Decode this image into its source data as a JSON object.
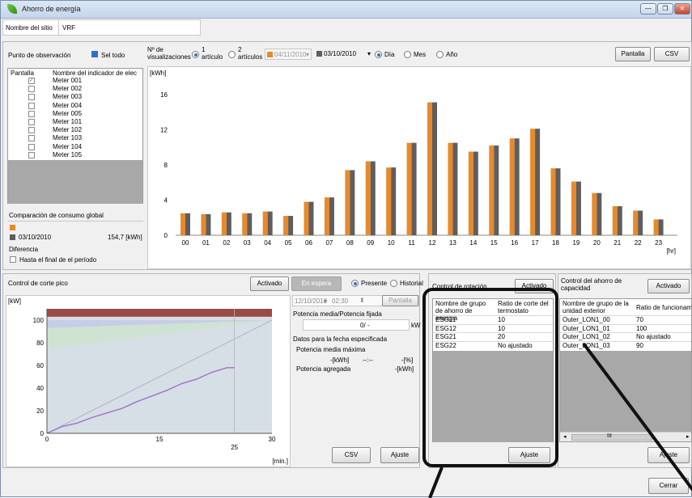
{
  "window": {
    "title": "Ahorro de energía",
    "min": "—",
    "max": "❐",
    "close": "✕"
  },
  "site": {
    "label": "Nombre del sitio",
    "value": "VRF"
  },
  "observation": {
    "label": "Punto de observación",
    "select_all": "Sel todo",
    "col_pantalla": "Pantalla",
    "col_name": "Nombre del indicador de elec",
    "meters": [
      "Meter 001",
      "Meter 002",
      "Meter 003",
      "Meter 004",
      "Meter 005",
      "Meter 101",
      "Meter 102",
      "Meter 103",
      "Meter 104",
      "Meter 105"
    ],
    "checked": [
      true,
      false,
      false,
      false,
      false,
      false,
      false,
      false,
      false,
      false
    ]
  },
  "global": {
    "label": "Comparación de consumo global",
    "date": "03/10/2010",
    "value": "154,7 [kWh]",
    "diff_label": "Diferencia",
    "end_period": "Hasta el final de el período"
  },
  "toolbar": {
    "num_label": "Nº de visualizaciones",
    "opt1": "1 artículo",
    "opt2": "2 artículos",
    "date1": "04/11/2010",
    "date2": "03/10/2010",
    "day": "Día",
    "month": "Mes",
    "year": "Año",
    "pantalla_btn": "Pantalla",
    "csv_btn": "CSV"
  },
  "colors": {
    "orange": "#e8892b",
    "gray": "#5e5e5e",
    "callout": "#111111"
  },
  "chart_data": {
    "type": "bar",
    "ylabel": "[kWh]",
    "xlabel": "[hr]",
    "ylim": [
      0,
      18
    ],
    "yticks": [
      0,
      4,
      8,
      12,
      16
    ],
    "categories": [
      "00",
      "01",
      "02",
      "03",
      "04",
      "05",
      "06",
      "07",
      "08",
      "09",
      "10",
      "11",
      "12",
      "13",
      "14",
      "15",
      "16",
      "17",
      "18",
      "19",
      "20",
      "21",
      "22",
      "23"
    ],
    "series": [
      {
        "values": [
          2.5,
          2.4,
          2.6,
          2.5,
          2.7,
          2.2,
          3.8,
          4.3,
          7.4,
          8.4,
          7.7,
          10.5,
          15.1,
          10.5,
          9.5,
          10.2,
          11.0,
          12.1,
          7.6,
          6.1,
          4.8,
          3.3,
          2.8,
          1.8
        ]
      },
      {
        "values": [
          2.5,
          2.4,
          2.6,
          2.5,
          2.7,
          2.2,
          3.8,
          4.3,
          7.4,
          8.4,
          7.7,
          10.5,
          15.1,
          10.5,
          9.5,
          10.2,
          11.0,
          12.1,
          7.6,
          6.1,
          4.8,
          3.3,
          2.8,
          1.8
        ]
      }
    ]
  },
  "peak": {
    "title": "Control de corte pico",
    "activated_btn": "Activado",
    "waiting_btn": "En espera",
    "present": "Presente",
    "history": "Historial",
    "ylabel": "[kW]",
    "xlabel": "[min.]",
    "yticks": [
      "0",
      "20",
      "40",
      "60",
      "80",
      "100"
    ],
    "xticks": [
      "0",
      "15",
      "25",
      "30"
    ],
    "date": "12/10/2010",
    "time": "02:30",
    "pantalla_btn": "Pantalla",
    "avg_fixed_label": "Potencia media/Potencia fijada",
    "avg_fixed_value": "0/ -",
    "kw_unit": "kW",
    "data_label": "Datos para la fecha especificada",
    "max_avg_label": "Potencia media máxima",
    "max_avg_kwh": "-[kWh]",
    "max_avg_dash": "--:--",
    "max_avg_pct": "-[%]",
    "added_label": "Potencia agregada",
    "added_value": "-[kWh]",
    "csv_btn": "CSV",
    "ajuste_btn": "Ajuste"
  },
  "rotation": {
    "title": "Control de rotación",
    "activated_btn": "Activado",
    "col1": "Nombre de grupo de ahorro de energía",
    "col2": "Ratio de corte del termostato",
    "rows": [
      [
        "ESG11",
        "10"
      ],
      [
        "ESG12",
        "10"
      ],
      [
        "ESG21",
        "20"
      ],
      [
        "ESG22",
        "No ajustado"
      ]
    ],
    "ajuste_btn": "Ajuste"
  },
  "capacity": {
    "title": "Control del ahorro de capacidad",
    "activated_btn": "Activado",
    "col1": "Nombre de grupo de la unidad exterior",
    "col2": "Ratio de funcionamie",
    "rows": [
      [
        "Outer_LON1_00",
        "70"
      ],
      [
        "Outer_LON1_01",
        "100"
      ],
      [
        "Outer_LON1_02",
        "No ajustado"
      ],
      [
        "Outer_LON1_03",
        "90"
      ]
    ],
    "ajuste_btn": "Ajuste",
    "scroll_mid": "III"
  },
  "close_btn": "Cerrar"
}
